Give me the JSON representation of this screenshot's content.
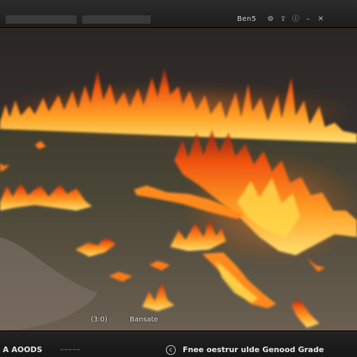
{
  "toolbar": {
    "label": "Ben5",
    "icons": [
      "settings-icon",
      "share-icon",
      "info-icon",
      "minimize-icon",
      "close-icon"
    ],
    "icon_glyphs": [
      "⚙",
      "⇪",
      "ⓘ",
      "–",
      "✕"
    ]
  },
  "viewport": {
    "timecode": "(3:0)",
    "caption": "Bansate"
  },
  "statusbar": {
    "app_name": "A AOODS",
    "small_tag": "~~~~~",
    "cc_glyph": "c",
    "status_text": "Fnee oestrur ulde Genood Grade"
  },
  "colors": {
    "flame_core": "#ffd84a",
    "flame_mid": "#ff7a14",
    "flame_edge": "#c2260a",
    "ground": "#4a4636",
    "sky": "#3b3633"
  }
}
